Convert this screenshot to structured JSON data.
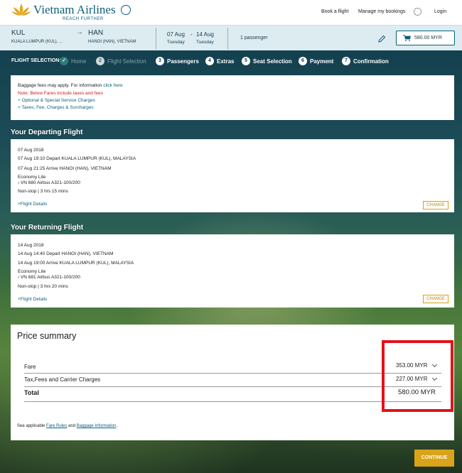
{
  "brand": {
    "name": "Vietnam Airlines",
    "tagline": "REACH FURTHER",
    "gold": "#d9a31a",
    "teal": "#0b5f7a",
    "highlight_red": "#e3121b"
  },
  "topnav": {
    "book_flight": "Book a flight",
    "my_bookings": "Manage my bookings",
    "settings_icon": "gear-icon",
    "login": "Login"
  },
  "search": {
    "origin_code": "KUL",
    "origin_city": "KUALA LUMPUR (KUL), ...",
    "arrow": "→",
    "destination_code": "HAN",
    "destination_city": "HANOI (HAN), VIETNAM",
    "depart_date": "07 Aug",
    "date_separator": "-",
    "return_date": "14 Aug",
    "depart_day": "Tuesday",
    "return_day": "Tuesday",
    "passengers": "1 passenger",
    "edit_icon": "pencil-icon",
    "cart_icon": "cart-icon",
    "cart_total": "580.00 MYR"
  },
  "steps": {
    "label": "FLIGHT SELECTION:",
    "items": [
      {
        "number": "✓",
        "label": "Home",
        "state": "done"
      },
      {
        "number": "2",
        "label": "Flight Selection",
        "state": "current"
      },
      {
        "number": "3",
        "label": "Passengers",
        "state": "todo"
      },
      {
        "number": "4",
        "label": "Extras",
        "state": "todo"
      },
      {
        "number": "5",
        "label": "Seat Selection",
        "state": "todo"
      },
      {
        "number": "6",
        "label": "Payment",
        "state": "todo"
      },
      {
        "number": "7",
        "label": "Confirmation",
        "state": "todo"
      }
    ]
  },
  "notice": {
    "line1": "Baggage fees may apply. For information ",
    "link": "click here",
    "line2": "Note: Below Fares include taxes and fees",
    "line3": "+ Optional & Special Service Charges",
    "line4": "+ Taxes, Fee, Charges & Surcharges"
  },
  "departing": {
    "title": "Your Departing Flight",
    "date": "07 Aug 2018",
    "depart": "07 Aug 19:10 Depart KUALA LUMPUR (KUL), MALAYSIA",
    "arrive": "07 Aug 21:25 Arrive HANOI (HAN), VIETNAM",
    "cabin": "Economy Lite",
    "flight": "› VN 680 Airbus A321-100/200",
    "duration": "Non-stop | 3 hrs 15 mins",
    "details": "Flight Details",
    "change": "CHANGE"
  },
  "returning": {
    "title": "Your Returning Flight",
    "date": "14 Aug 2018",
    "depart": "14 Aug 14:40 Depart HANOI (HAN), VIETNAM",
    "arrive": "14 Aug 19:00 Arrive KUALA LUMPUR (KUL), MALAYSIA",
    "cabin": "Economy Lite",
    "flight": "› VN 681 Airbus A321-100/200",
    "duration": "Non-stop | 3 hrs 20 mins",
    "details": "Flight Details",
    "change": "CHANGE"
  },
  "price_summary": {
    "title": "Price summary",
    "fare_label": "Fare",
    "fare_value": "353.00 MYR",
    "tax_label": "Tax,Fees and Carrier Charges",
    "tax_value": "227.00 MYR",
    "total_label": "Total",
    "total_value": "580.00 MYR",
    "footer_prefix": "See applicable ",
    "fare_rules": "Fare Rules",
    "footer_and": " and ",
    "baggage_info": "Baggage Information",
    "footer_suffix": "."
  },
  "continue_label": "CONTINUE"
}
